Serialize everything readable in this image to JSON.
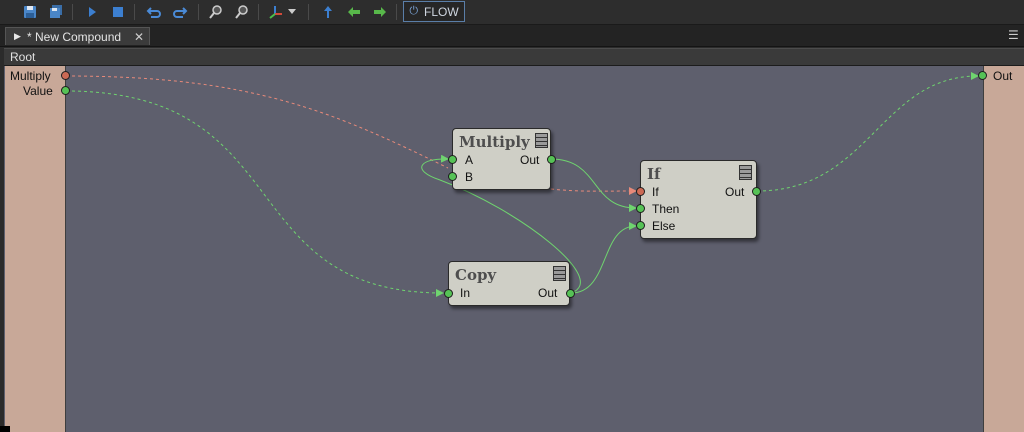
{
  "toolbar": {
    "icons": [
      "save-icon",
      "save-all-icon",
      "play-icon",
      "stop-icon",
      "undo-icon",
      "redo-icon",
      "zoom-in-icon",
      "zoom-out-icon",
      "axis-icon",
      "dropdown-arrow-icon",
      "up-level-icon",
      "back-arrow-icon",
      "forward-arrow-icon"
    ],
    "flow_label": "FLOW"
  },
  "tab": {
    "label": "* New Compound",
    "close": "✕"
  },
  "breadcrumb": {
    "label": "Root"
  },
  "inputs": [
    {
      "label": "Multiply"
    },
    {
      "label": "Value"
    }
  ],
  "outputs": [
    {
      "label": "Out"
    }
  ],
  "nodes": {
    "multiply": {
      "title": "Multiply",
      "port_a": "A",
      "port_b": "B",
      "out": "Out"
    },
    "copy": {
      "title": "Copy",
      "in": "In",
      "out": "Out"
    },
    "if": {
      "title": "If",
      "if": "If",
      "then": "Then",
      "else": "Else",
      "out": "Out"
    }
  },
  "colors": {
    "canvas": "#5e5f6d",
    "side_panel": "#c8a898",
    "node": "#cfcfc6",
    "wire_green": "#6fd46f",
    "wire_red": "#e88a7a",
    "accent": "#5a7ea8"
  }
}
